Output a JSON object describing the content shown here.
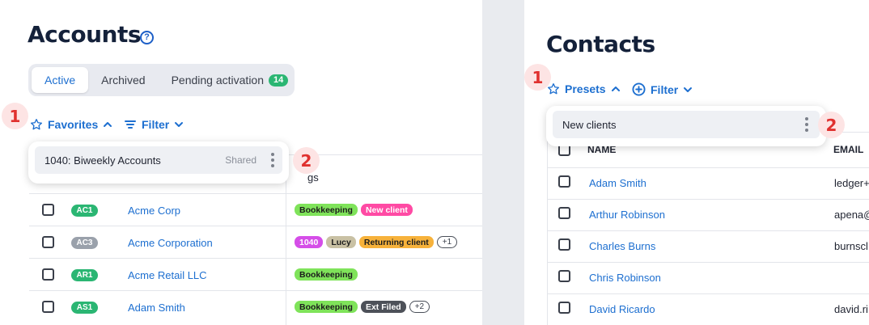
{
  "accounts": {
    "title": "Accounts",
    "help_icon": "?",
    "tabs": [
      {
        "label": "Active",
        "active": true
      },
      {
        "label": "Archived",
        "active": false
      },
      {
        "label": "Pending activation",
        "badge": "14",
        "active": false
      }
    ],
    "step1": "1",
    "step2": "2",
    "favorites_label": "Favorites",
    "filter_label": "Filter",
    "preset": {
      "name": "1040: Biweekly Accounts",
      "shared": "Shared"
    },
    "tags_header_fragment": "gs",
    "rows": [
      {
        "code": "AC1",
        "code_color": "#2bb673",
        "name": "Acme Corp",
        "tags": [
          {
            "label": "Bookkeeping",
            "color": "#7fe35a"
          },
          {
            "label": "New client",
            "color": "#ff4aa4",
            "text": "#ffffff"
          }
        ]
      },
      {
        "code": "AC3",
        "code_color": "#9aa1ab",
        "name": "Acme Corporation",
        "tags": [
          {
            "label": "1040",
            "color": "#d54ee8",
            "text": "#ffffff"
          },
          {
            "label": "Lucy",
            "color": "#c9c1a4"
          },
          {
            "label": "Returning client",
            "color": "#f7b23b"
          }
        ],
        "more": "+1"
      },
      {
        "code": "AR1",
        "code_color": "#2bb673",
        "name": "Acme Retail LLC",
        "tags": [
          {
            "label": "Bookkeeping",
            "color": "#7fe35a"
          }
        ]
      },
      {
        "code": "AS1",
        "code_color": "#2bb673",
        "name": "Adam Smith",
        "tags": [
          {
            "label": "Bookkeeping",
            "color": "#7fe35a"
          },
          {
            "label": "Ext Filed",
            "color": "#4d5159",
            "text": "#ffffff"
          }
        ],
        "more": "+2"
      }
    ]
  },
  "contacts": {
    "title": "Contacts",
    "step1": "1",
    "step2": "2",
    "presets_label": "Presets",
    "filter_label": "Filter",
    "preset": {
      "name": "New clients"
    },
    "columns": {
      "name": "NAME",
      "email": "EMAIL"
    },
    "rows": [
      {
        "name": "Adam Smith",
        "email": "ledger+"
      },
      {
        "name": "Arthur Robinson",
        "email": "apena@"
      },
      {
        "name": "Charles Burns",
        "email": "burnscl"
      },
      {
        "name": "Chris Robinson",
        "email": ""
      },
      {
        "name": "David Ricardo",
        "email": "david.ri"
      }
    ]
  },
  "colors": {
    "accent": "#1d6fd0",
    "step": "#e0312f",
    "step_bg": "#fde4e4"
  }
}
